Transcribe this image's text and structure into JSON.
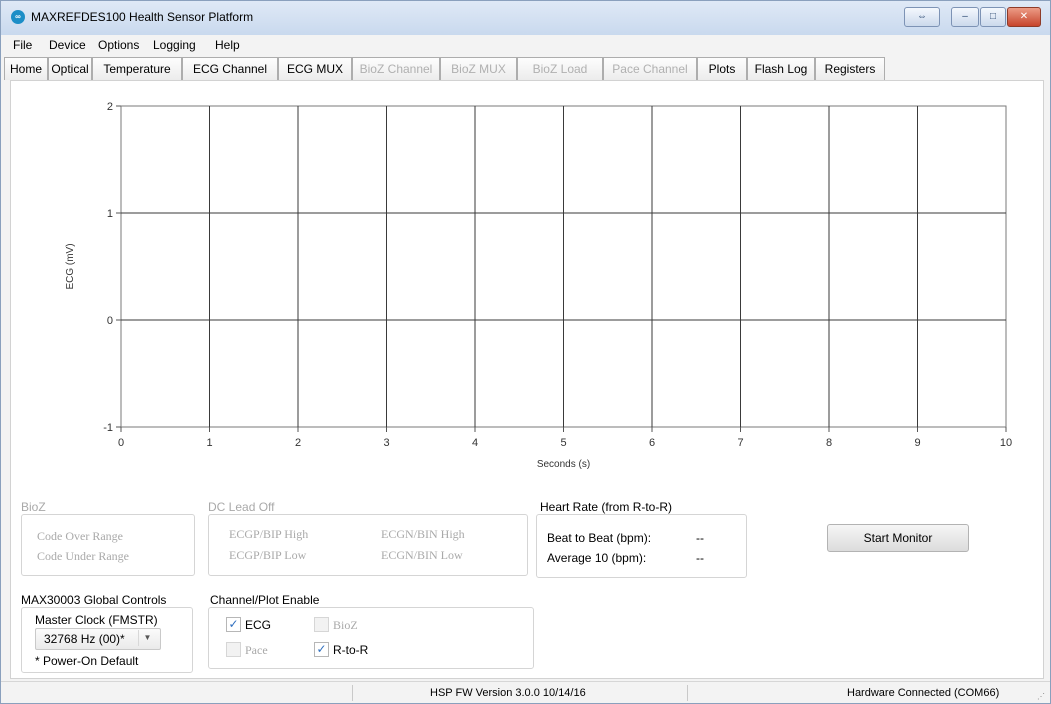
{
  "window": {
    "title": "MAXREFDES100 Health Sensor Platform",
    "icon_glyph": "∞",
    "controls": {
      "restore": "⇔",
      "minimize": "–",
      "maximize": "□",
      "close": "✕"
    }
  },
  "menu": [
    "File",
    "Device",
    "Options",
    "Logging",
    "Help"
  ],
  "tabs": [
    {
      "label": "Home",
      "state": "normal"
    },
    {
      "label": "Optical",
      "state": "normal"
    },
    {
      "label": "Temperature",
      "state": "normal"
    },
    {
      "label": "ECG Channel",
      "state": "normal"
    },
    {
      "label": "ECG MUX",
      "state": "normal"
    },
    {
      "label": "BioZ Channel",
      "state": "disabled"
    },
    {
      "label": "BioZ MUX",
      "state": "disabled"
    },
    {
      "label": "BioZ Load",
      "state": "disabled"
    },
    {
      "label": "Pace Channel",
      "state": "disabled"
    },
    {
      "label": "Plots",
      "state": "active"
    },
    {
      "label": "Flash Log",
      "state": "normal"
    },
    {
      "label": "Registers",
      "state": "normal"
    }
  ],
  "chart_data": {
    "type": "line",
    "xlabel": "Seconds (s)",
    "ylabel": "ECG (mV)",
    "xlim": [
      0,
      10
    ],
    "ylim": [
      -1,
      2
    ],
    "x_ticks": [
      0,
      1,
      2,
      3,
      4,
      5,
      6,
      7,
      8,
      9,
      10
    ],
    "y_ticks": [
      -1,
      0,
      1,
      2
    ],
    "grid": true,
    "series": []
  },
  "bioz": {
    "title": "BioZ",
    "items": [
      "Code Over Range",
      "Code Under Range"
    ]
  },
  "dc_lead_off": {
    "title": "DC Lead Off",
    "items": [
      "ECGP/BIP High",
      "ECGN/BIN High",
      "ECGP/BIP Low",
      "ECGN/BIN Low"
    ]
  },
  "heart_rate": {
    "title": "Heart Rate (from R-to-R)",
    "beat_label": "Beat to Beat (bpm):",
    "beat_value": "--",
    "avg_label": "Average 10 (bpm):",
    "avg_value": "--"
  },
  "start_monitor_label": "Start Monitor",
  "global_controls": {
    "title": "MAX30003 Global Controls",
    "clock_label": "Master Clock (FMSTR)",
    "clock_value": "32768 Hz (00)*",
    "note": "* Power-On Default"
  },
  "channel_enable": {
    "title": "Channel/Plot Enable",
    "ecg": {
      "label": "ECG",
      "checked": true
    },
    "bioz": {
      "label": "BioZ",
      "checked": false
    },
    "pace": {
      "label": "Pace",
      "checked": false
    },
    "rtor": {
      "label": "R-to-R",
      "checked": true
    },
    "check_glyph": "✓"
  },
  "status": {
    "fw": "HSP FW Version 3.0.0 10/14/16",
    "connection": "Hardware Connected (COM66)"
  }
}
